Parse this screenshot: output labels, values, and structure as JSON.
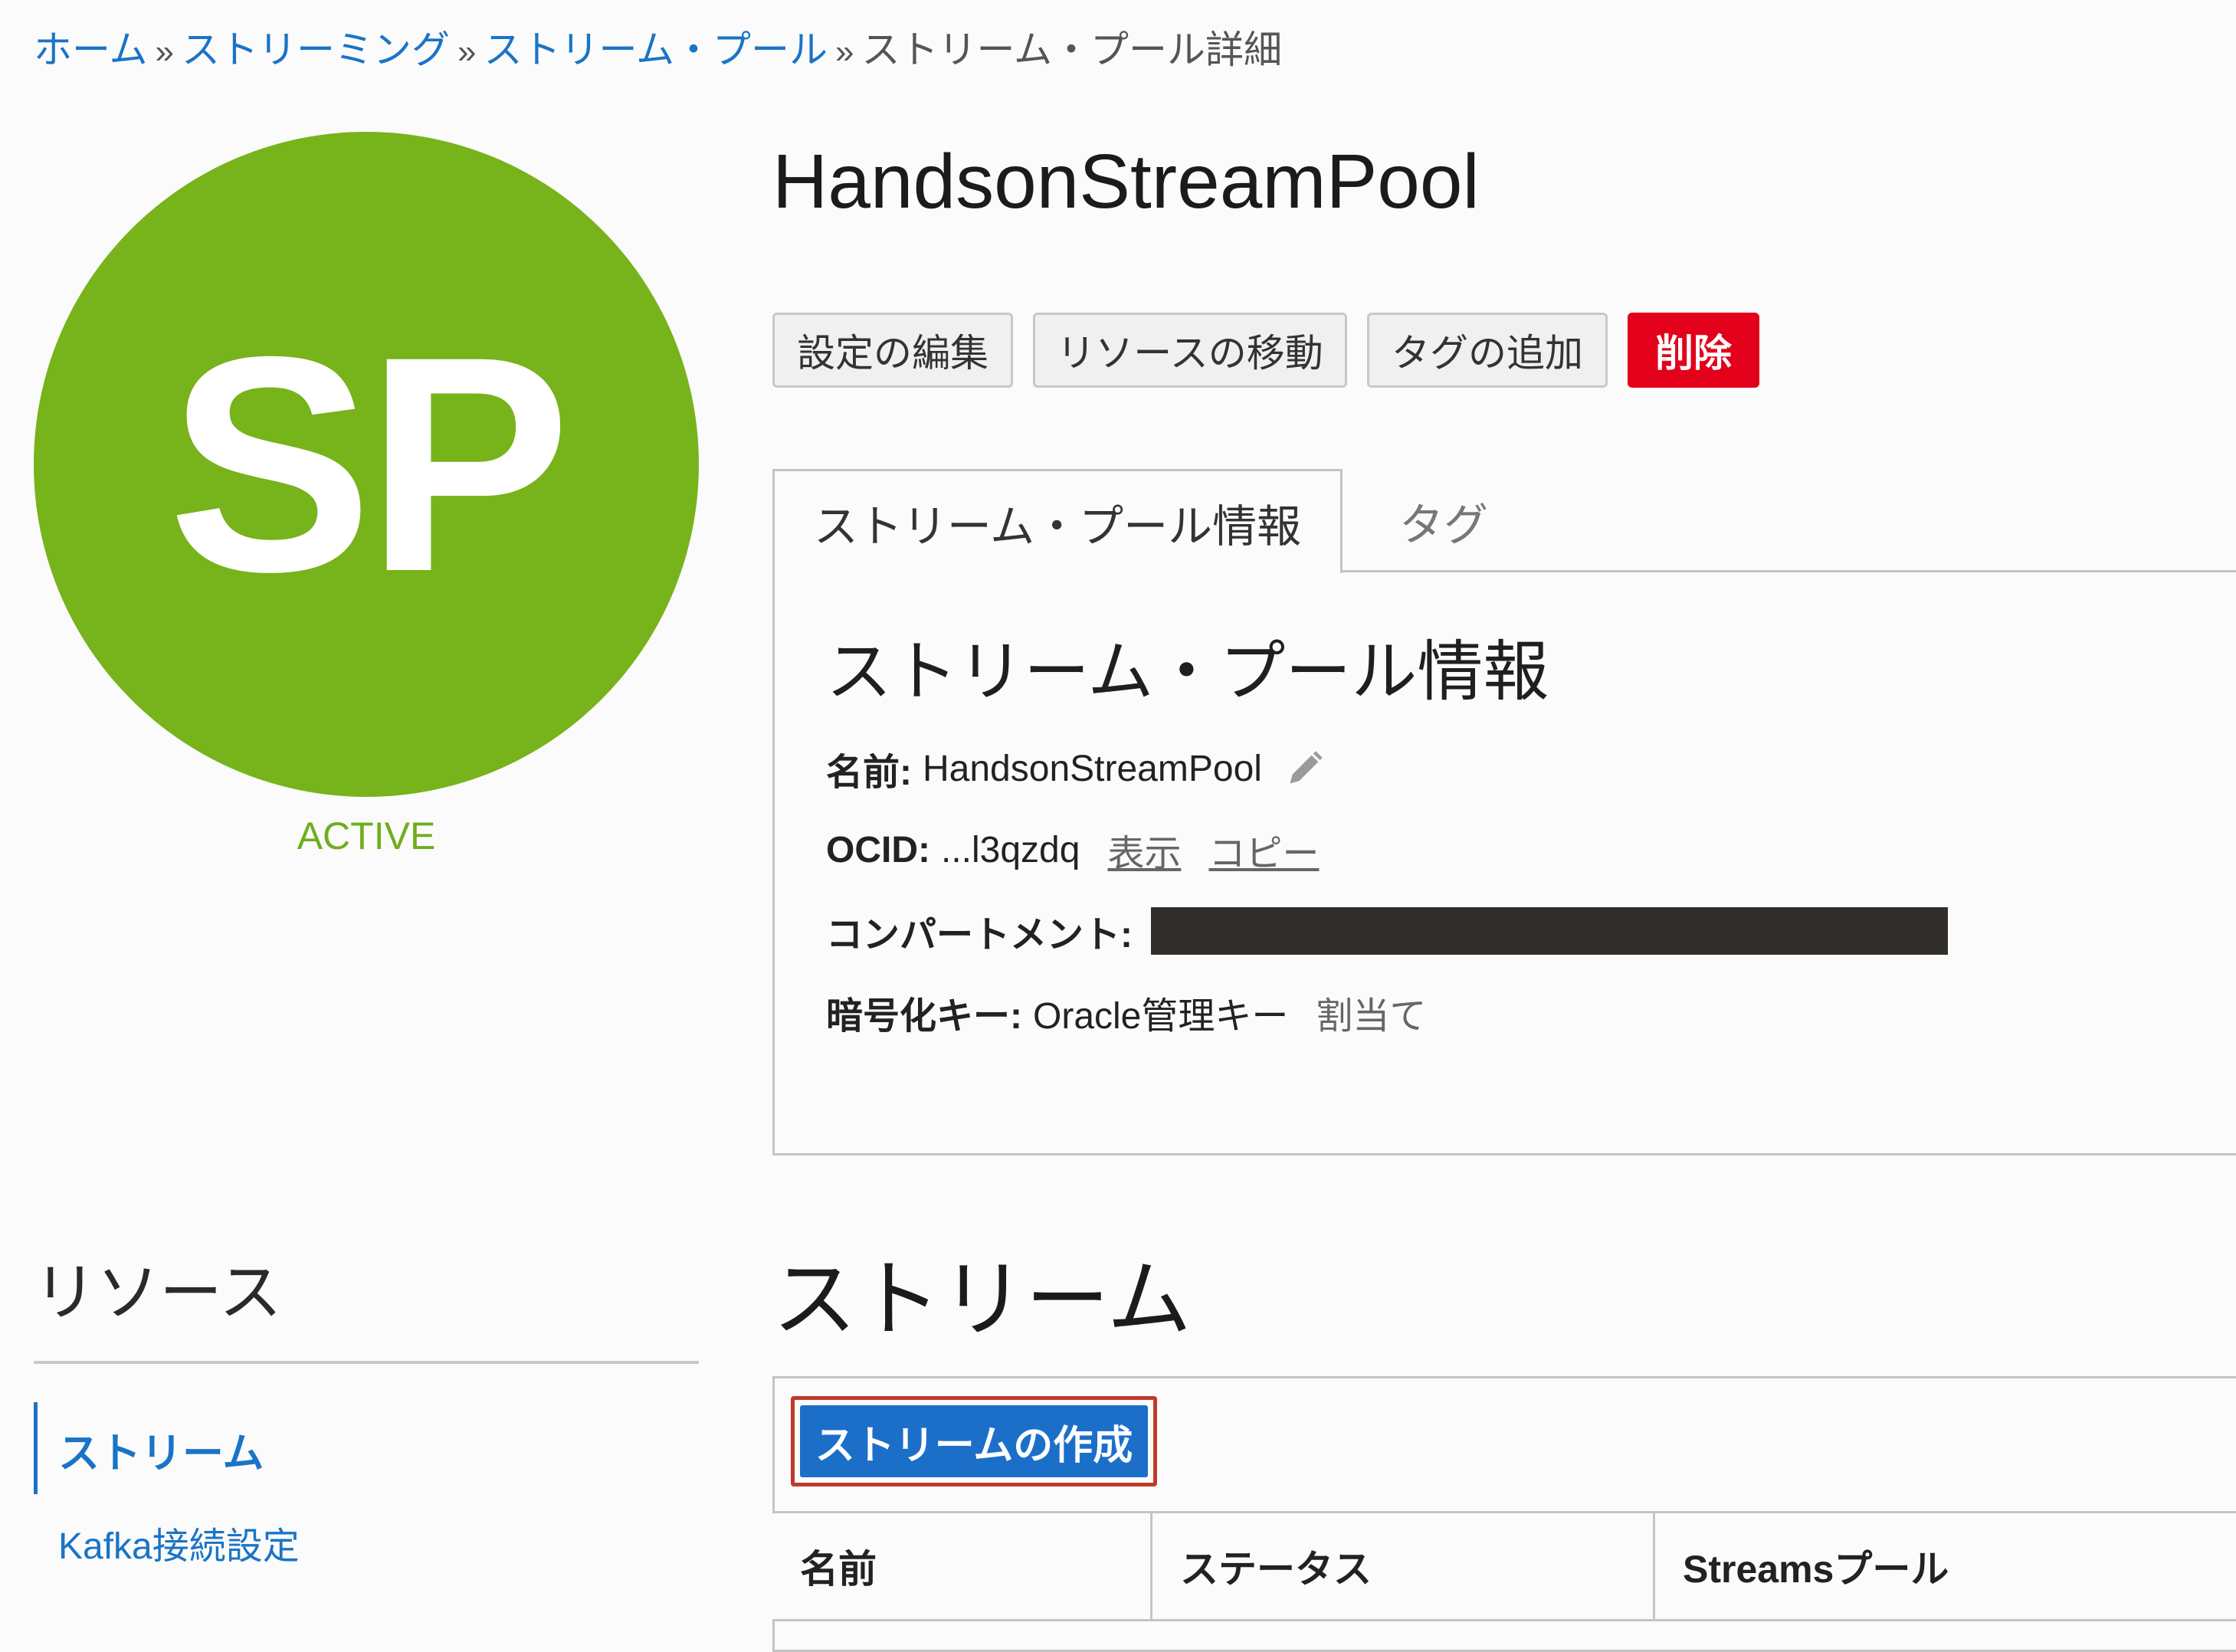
{
  "breadcrumb": {
    "home": "ホーム",
    "streaming": "ストリーミング",
    "stream_pools": "ストリーム・プール",
    "current": "ストリーム・プール詳細",
    "separator": "»"
  },
  "avatar": {
    "initials": "SP",
    "color": "#77b31a"
  },
  "status": "ACTIVE",
  "title": "HandsonStreamPool",
  "actions": {
    "edit": "設定の編集",
    "move": "リソースの移動",
    "add_tags": "タグの追加",
    "delete": "削除"
  },
  "tabs": {
    "info": "ストリーム・プール情報",
    "tags": "タグ"
  },
  "info": {
    "heading": "ストリーム・プール情報",
    "name_label": "名前:",
    "name_value": "HandsonStreamPool",
    "ocid_label": "OCID:",
    "ocid_value": "...l3qzdq",
    "ocid_show": "表示",
    "ocid_copy": "コピー",
    "compartment_label": "コンパートメント:",
    "key_label": "暗号化キー:",
    "key_value": "Oracle管理キー",
    "key_assign": "割当て"
  },
  "resources": {
    "title": "リソース",
    "items": [
      {
        "label": "ストリーム",
        "active": true
      },
      {
        "label": "Kafka接続設定",
        "active": false
      }
    ]
  },
  "streams": {
    "heading": "ストリーム",
    "create_button": "ストリームの作成",
    "columns": [
      "名前",
      "ステータス",
      "Streamsプール"
    ]
  },
  "colors": {
    "link": "#1a74c6",
    "danger": "#e3001b",
    "primary": "#1c6fc9",
    "highlight": "#c0392b",
    "active": "#6fae1c"
  },
  "icons": {
    "edit_name": "pencil-icon"
  }
}
